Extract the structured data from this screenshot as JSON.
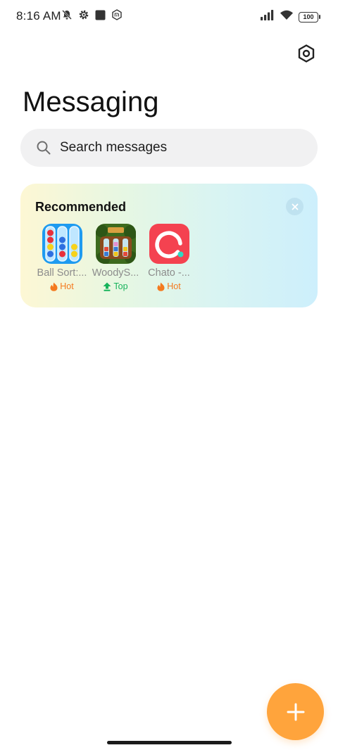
{
  "status_bar": {
    "time": "8:16 AM",
    "battery": "100",
    "icons": [
      "notifications-off-icon",
      "gear-icon",
      "square-icon",
      "mi-icon",
      "signal-icon",
      "wifi-icon",
      "battery-icon"
    ]
  },
  "header": {
    "title": "Messaging",
    "settings_icon": "hexagon-settings-icon"
  },
  "search": {
    "placeholder": "Search messages"
  },
  "recommended": {
    "title": "Recommended",
    "apps": [
      {
        "name": "Ball Sort:...",
        "badge": "Hot",
        "badge_type": "hot"
      },
      {
        "name": "WoodyS...",
        "badge": "Top",
        "badge_type": "top"
      },
      {
        "name": "Chato -...",
        "badge": "Hot",
        "badge_type": "hot"
      }
    ]
  },
  "colors": {
    "accent": "#ffa43c",
    "hot": "#f47a1f",
    "top": "#17b35b",
    "search_bg": "#f1f1f2"
  }
}
